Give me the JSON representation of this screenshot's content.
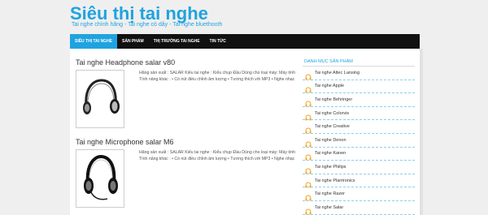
{
  "header": {
    "title": "Siêu thị tai nghe",
    "description": "Tai nghe chính hãng - Tai nghe có dây - Tai nghe bluethooth"
  },
  "nav": {
    "items": [
      "Siêu thị tai nghe",
      "Sản phẩm",
      "Thị trường tai nghe",
      "Tin tức"
    ],
    "active_index": 0
  },
  "posts": [
    {
      "title": "Tai nghe Headphone salar v80",
      "excerpt": "Hãng sản xuất : SALAR Kiểu tai nghe : Kiểu chụp Đầu Dùng cho loại máy: Máy tính Tính năng khác : • Có nút điều chỉnh âm lượng • Tương thích với MP3 • Nghe nhạc"
    },
    {
      "title": "Tai nghe Microphone salar M6",
      "excerpt": "Hãng sản xuất : SALAR Kiểu tai nghe : Kiểu chụp Đầu Dùng cho loại máy: Máy tính Tính năng khác : • Có nút điều chỉnh âm lượng • Tương thích với MP3 • Nghe nhạc"
    }
  ],
  "sidebar": {
    "title": "Danh mục sản phẩm",
    "items": [
      "Tai nghe Altec Lansing",
      "Tai nghe Apple",
      "Tai nghe Behringer",
      "Tai nghe Colorvis",
      "Tai nghe Creative",
      "Tai nghe Denon",
      "Tai nghe Kanen",
      "Tai nghe Philips",
      "Tai nghe Plantronics",
      "Tai nghe Razer",
      "Tai nghe Salar"
    ]
  },
  "colors": {
    "accent": "#1fa3e0",
    "nav_bg": "#111111",
    "icon_orange": "#f5a623"
  }
}
